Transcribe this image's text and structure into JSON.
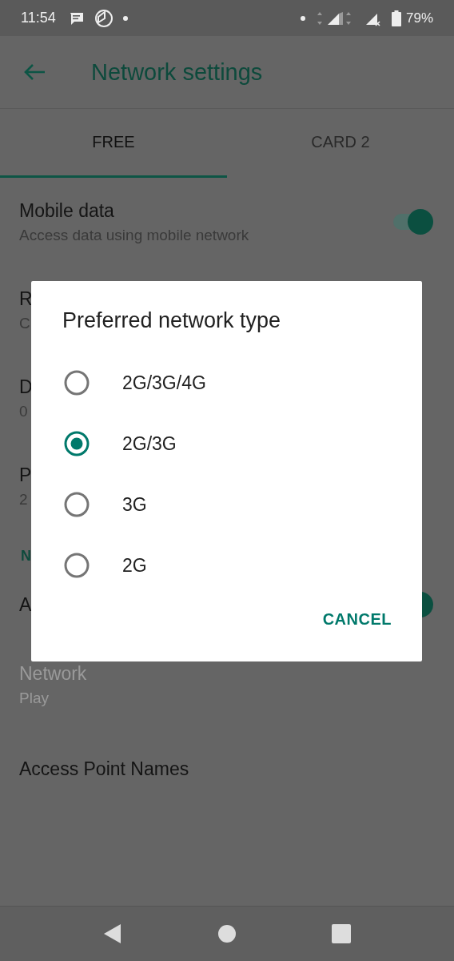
{
  "status_bar": {
    "time": "11:54",
    "battery": "79%"
  },
  "app_bar": {
    "title": "Network settings"
  },
  "tabs": [
    {
      "label": "FREE",
      "selected": true
    },
    {
      "label": "CARD 2",
      "selected": false
    }
  ],
  "items": [
    {
      "kind": "toggle",
      "title": "Mobile data",
      "subtitle": "Access data using mobile network",
      "on": true,
      "disabled": false
    },
    {
      "kind": "text",
      "title": "R",
      "subtitle": "C",
      "disabled": false
    },
    {
      "kind": "text",
      "title": "D",
      "subtitle": "0",
      "disabled": false
    },
    {
      "kind": "text",
      "title": "P",
      "subtitle": "2",
      "disabled": false
    },
    {
      "kind": "header",
      "title": "N"
    },
    {
      "kind": "toggle",
      "title": "A",
      "on": true,
      "disabled": false
    },
    {
      "kind": "text",
      "title": "Network",
      "subtitle": "Play",
      "disabled": true
    },
    {
      "kind": "text",
      "title": "Access Point Names",
      "disabled": false
    }
  ],
  "dialog": {
    "title": "Preferred network type",
    "options": [
      {
        "label": "2G/3G/4G",
        "selected": false
      },
      {
        "label": "2G/3G",
        "selected": true
      },
      {
        "label": "3G",
        "selected": false
      },
      {
        "label": "2G",
        "selected": false
      }
    ],
    "buttons": [
      "CANCEL"
    ]
  }
}
